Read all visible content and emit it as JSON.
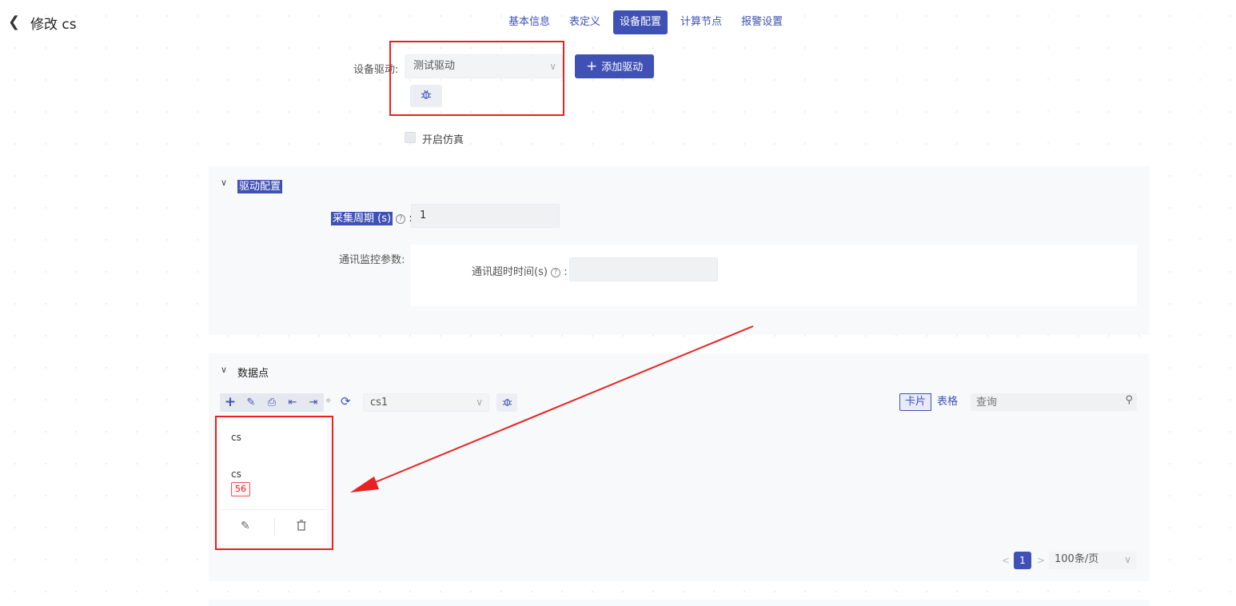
{
  "header": {
    "back_icon": "chevron-left-icon",
    "title": "修改 cs",
    "tabs": [
      "基本信息",
      "表定义",
      "设备配置",
      "计算节点",
      "报警设置"
    ],
    "active_tab": "设备配置"
  },
  "driver": {
    "label": "设备驱动:",
    "selected": "测试驱动",
    "add_button": "添加驱动",
    "debug_icon": "bug-icon",
    "simulation_label": "开启仿真",
    "simulation_checked": false
  },
  "driver_config": {
    "title": "驱动配置",
    "collect_period_label": "采集周期 (s)",
    "collect_period_value": "1",
    "monitor_label": "通讯监控参数:",
    "timeout_label": "通讯超时时间(s)",
    "timeout_value": ""
  },
  "datapoints": {
    "title": "数据点",
    "toolbar_icons": [
      "plus-icon",
      "edit-icon",
      "print-icon",
      "import-icon",
      "export-icon",
      "locate-icon",
      "refresh-icon"
    ],
    "group_select": "cs1",
    "view_card": "卡片",
    "view_table": "表格",
    "search_placeholder": "查询",
    "card": {
      "name": "cs",
      "sub_name": "cs",
      "badge": "56"
    },
    "pagination": {
      "current_page": "1",
      "page_size": "100条/页"
    }
  },
  "colors": {
    "accent": "#3f51b5",
    "annotation": "#e82222",
    "badge": "#d22222"
  }
}
